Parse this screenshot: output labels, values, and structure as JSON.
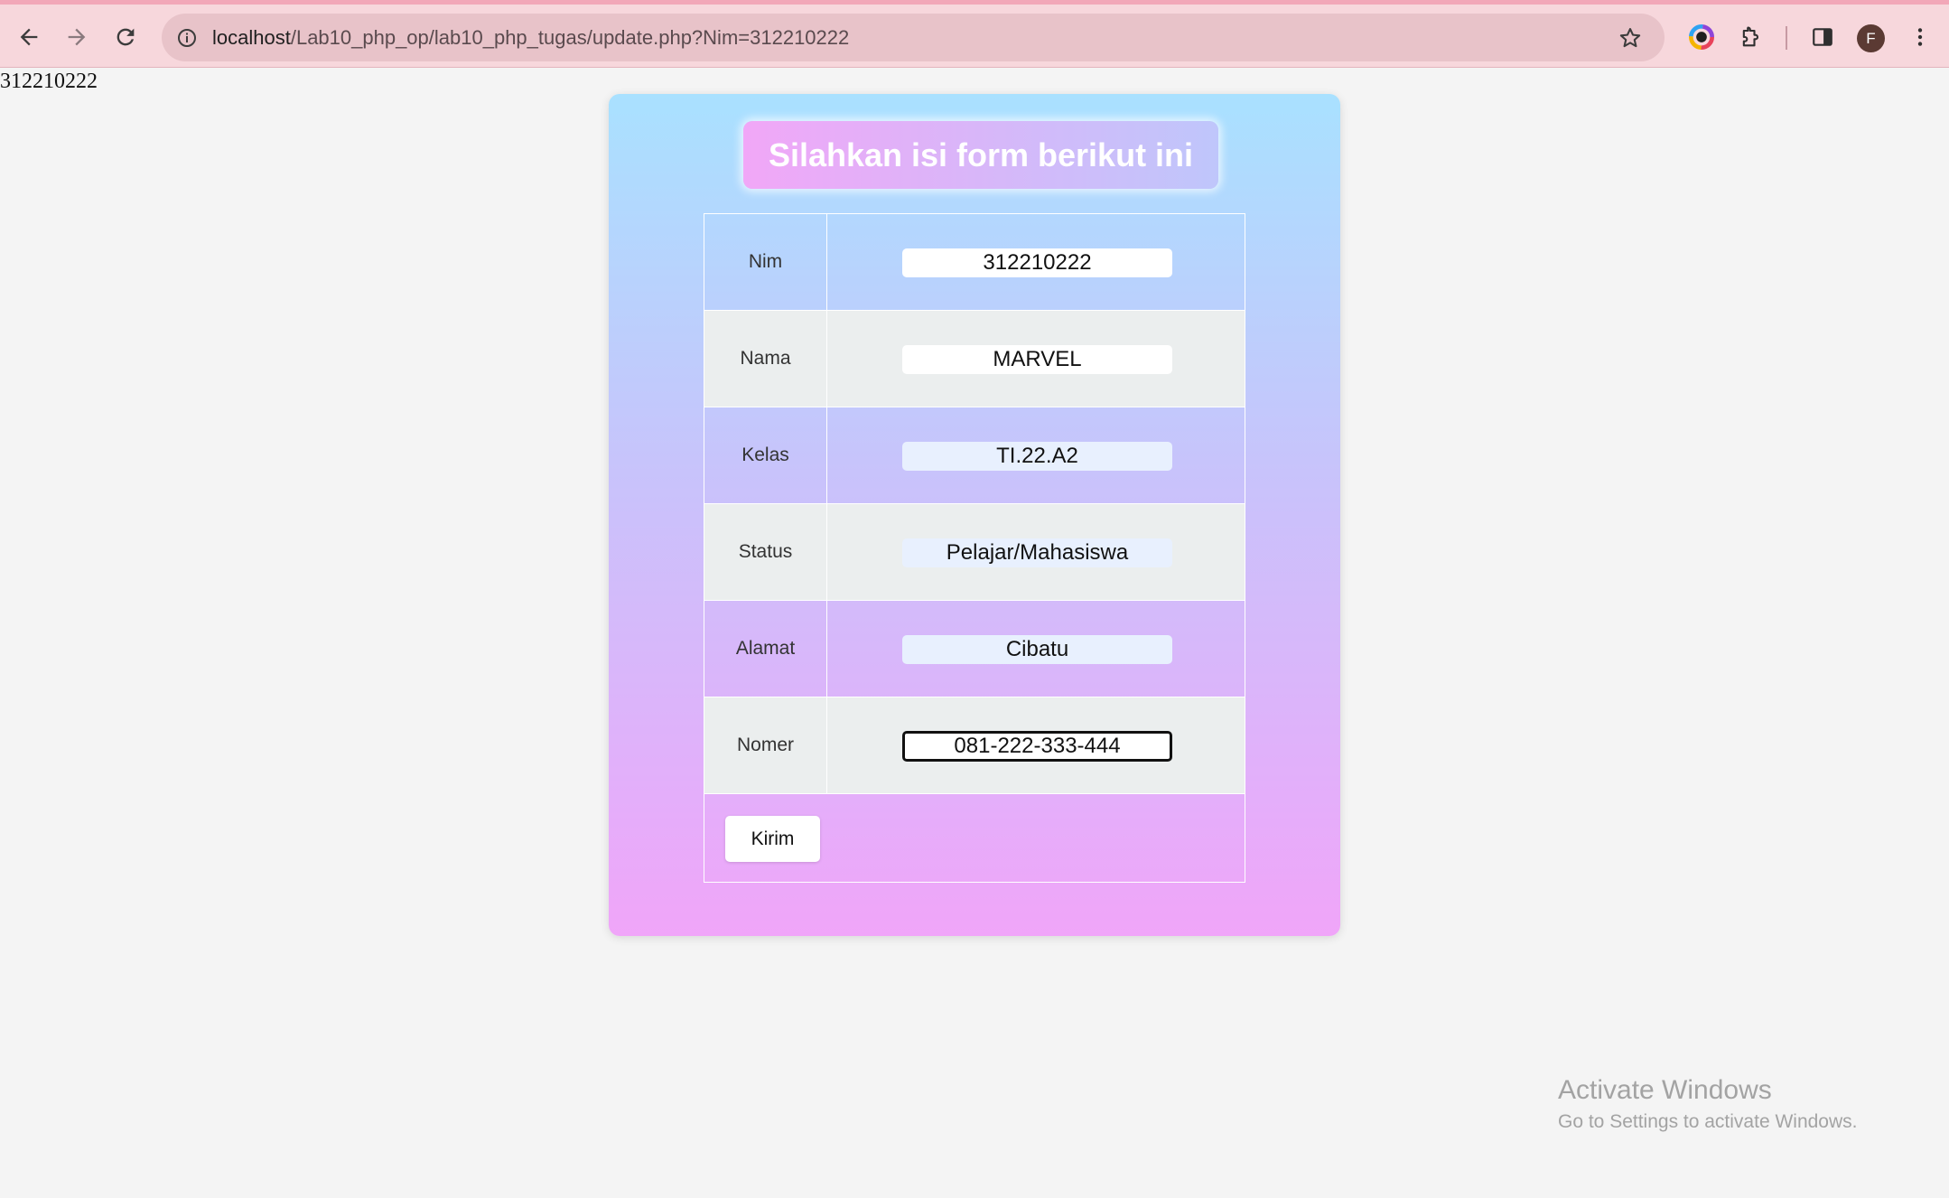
{
  "browser": {
    "url_host": "localhost",
    "url_path": "/Lab10_php_op/lab10_php_tugas/update.php?Nim=312210222",
    "profile_initial": "F",
    "icons": {
      "back": "back-arrow-icon",
      "forward": "forward-arrow-icon",
      "reload": "reload-icon",
      "site_info": "site-info-icon",
      "bookmark": "star-icon",
      "color_extension": "color-wheel-icon",
      "extensions": "puzzle-icon",
      "side_panel": "side-panel-icon",
      "menu": "kebab-menu-icon"
    }
  },
  "page": {
    "echo_text": "312210222",
    "form": {
      "title": "Silahkan isi form berikut ini",
      "fields": [
        {
          "label": "Nim",
          "value": "312210222"
        },
        {
          "label": "Nama",
          "value": "MARVEL"
        },
        {
          "label": "Kelas",
          "value": "TI.22.A2"
        },
        {
          "label": "Status",
          "value": "Pelajar/Mahasiswa"
        },
        {
          "label": "Alamat",
          "value": "Cibatu"
        },
        {
          "label": "Nomer",
          "value": "081-222-333-444"
        }
      ],
      "submit_label": "Kirim"
    }
  },
  "watermark": {
    "title": "Activate Windows",
    "subtitle": "Go to Settings to activate Windows."
  },
  "colors": {
    "card_top": "#a9e1ff",
    "card_bottom": "#f0a5f9",
    "title_left": "#f1a7f7",
    "title_right": "#bfc6fb",
    "toolbar_bg": "#f7d7dc"
  }
}
